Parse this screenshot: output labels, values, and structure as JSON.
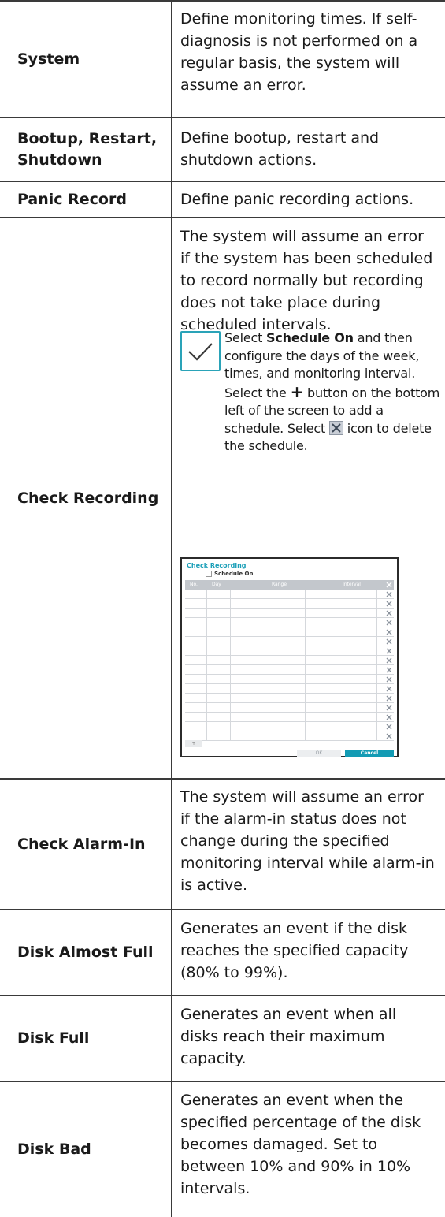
{
  "rows": [
    {
      "label": "System",
      "desc": "Define monitoring times. If self-diagnosis is not performed on a regular basis, the system will assume an error."
    },
    {
      "label": "Bootup, Restart, Shutdown",
      "desc": "Define bootup, restart and shutdown actions."
    },
    {
      "label": "Panic Record",
      "desc": "Define panic recording actions."
    },
    {
      "label": "Check Recording",
      "desc": "The system will assume an error if the system has been scheduled to record normally but recording does not take place during scheduled intervals."
    },
    {
      "label": "Check Alarm-In",
      "desc": "The system will assume an error if the alarm-in status does not change during the specified monitoring interval while alarm-in is active."
    },
    {
      "label": "Disk Almost Full",
      "desc": "Generates an event if the disk reaches the specified capacity (80% to 99%)."
    },
    {
      "label": "Disk Full",
      "desc": "Generates an event when all disks reach their maximum capacity."
    },
    {
      "label": "Disk Bad",
      "desc": "Generates an event when the specified percentage of the disk becomes damaged. Set to between 10% and 90% in 10% intervals."
    }
  ],
  "note": {
    "part1": "Select ",
    "bold": "Schedule On",
    "part2": " and then configure the days of the week, times, and monitoring interval. Select the ",
    "plus_glyph": "+",
    "part3": " button on the bottom left of the screen to add a schedule. Select ",
    "part4": " icon to delete the schedule."
  },
  "screenshot": {
    "title": "Check Recording",
    "checkbox_label": "Schedule On",
    "columns": [
      "No.",
      "Day",
      "Range",
      "Interval"
    ],
    "add_label": "+",
    "ok_label": "OK",
    "cancel_label": "Cancel",
    "accent": "#1b9fb8"
  },
  "colors": {
    "rule": "#3a3a3a",
    "check_accent": "#2aa3b8"
  }
}
